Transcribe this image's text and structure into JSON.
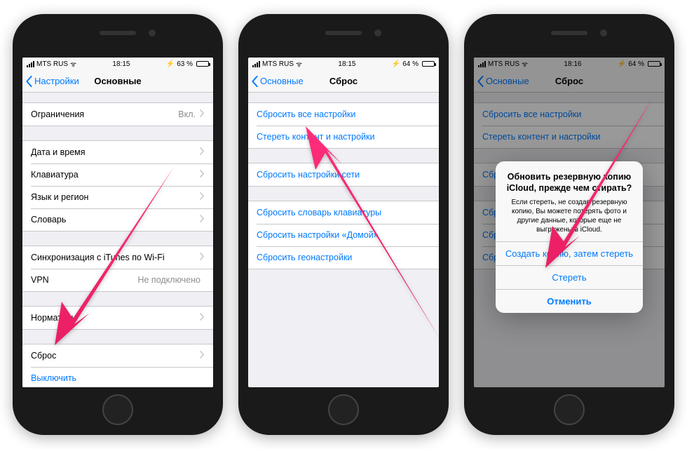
{
  "phones": [
    {
      "status": {
        "carrier": "MTS RUS",
        "time": "18:15",
        "battery_pct": "63 %",
        "battery_fill": 63,
        "bt": "⚡"
      },
      "nav": {
        "back": "Настройки",
        "title": "Основные"
      },
      "groups": [
        [
          {
            "label": "Ограничения",
            "value": "Вкл.",
            "chev": true
          }
        ],
        [
          {
            "label": "Дата и время",
            "chev": true
          },
          {
            "label": "Клавиатура",
            "chev": true
          },
          {
            "label": "Язык и регион",
            "chev": true
          },
          {
            "label": "Словарь",
            "chev": true
          }
        ],
        [
          {
            "label": "Синхронизация с iTunes по Wi-Fi",
            "chev": true
          },
          {
            "label": "VPN",
            "value": "Не подключено"
          }
        ],
        [
          {
            "label": "Нормативы",
            "chev": true
          }
        ],
        [
          {
            "label": "Сброс",
            "chev": true
          },
          {
            "label": "Выключить",
            "link": true
          }
        ]
      ]
    },
    {
      "status": {
        "carrier": "MTS RUS",
        "time": "18:15",
        "battery_pct": "64 %",
        "battery_fill": 64,
        "bt": "⚡"
      },
      "nav": {
        "back": "Основные",
        "title": "Сброс"
      },
      "groups": [
        [
          {
            "label": "Сбросить все настройки",
            "link": true
          },
          {
            "label": "Стереть контент и настройки",
            "link": true
          }
        ],
        [
          {
            "label": "Сбросить настройки сети",
            "link": true
          }
        ],
        [
          {
            "label": "Сбросить словарь клавиатуры",
            "link": true
          },
          {
            "label": "Сбросить настройки «Домой»",
            "link": true
          },
          {
            "label": "Сбросить геонастройки",
            "link": true
          }
        ]
      ]
    },
    {
      "status": {
        "carrier": "MTS RUS",
        "time": "18:16",
        "battery_pct": "64 %",
        "battery_fill": 64,
        "bt": "⚡"
      },
      "nav": {
        "back": "Основные",
        "title": "Сброс"
      },
      "groups": [
        [
          {
            "label": "Сбросить все настройки",
            "link": true
          },
          {
            "label": "Стереть контент и настройки",
            "link": true
          }
        ],
        [
          {
            "label": "Сбросить настройки сети",
            "link": true
          }
        ],
        [
          {
            "label": "Сбросить словарь клавиатуры",
            "link": true
          },
          {
            "label": "Сбросить настройки «Домой»",
            "link": true
          },
          {
            "label": "Сбросить геонастройки",
            "link": true
          }
        ]
      ],
      "alert": {
        "title": "Обновить резервную копию iCloud, прежде чем стирать?",
        "message": "Если стереть, не создав резервную копию, Вы можете потерять фото и другие данные, которые еще не выгружены в iCloud.",
        "buttons": [
          {
            "label": "Создать копию, затем стереть",
            "bold": false
          },
          {
            "label": "Стереть",
            "bold": false
          },
          {
            "label": "Отменить",
            "bold": true
          }
        ]
      }
    }
  ],
  "arrow_color": "#e91e63"
}
